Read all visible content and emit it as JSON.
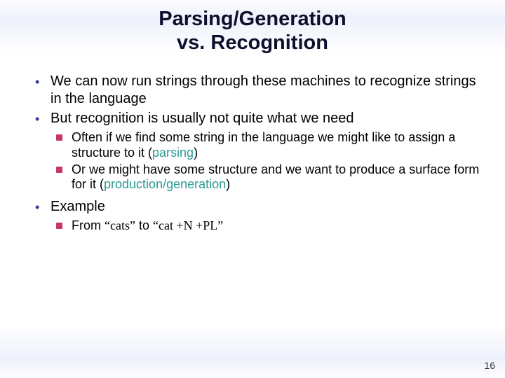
{
  "title_line1": "Parsing/Generation",
  "title_line2": "vs. Recognition",
  "bullets": {
    "b1": "We can now run strings through these machines to recognize strings in the language",
    "b2": "But recognition is usually not quite what we need",
    "b2_sub": {
      "s1_pre": "Often if we find some string in the language we might like to assign a  structure to it (",
      "s1_em": "parsing",
      "s1_post": ")",
      "s2_pre": "Or we might have some structure and we want to produce a surface form for it (",
      "s2_em": "production/generation",
      "s2_post": ")"
    },
    "b3": "Example",
    "b3_sub": {
      "s1_a": "From ",
      "s1_q1": "“cats”",
      "s1_b": " to ",
      "s1_q2": "“cat +N +PL”"
    }
  },
  "page_number": "16"
}
